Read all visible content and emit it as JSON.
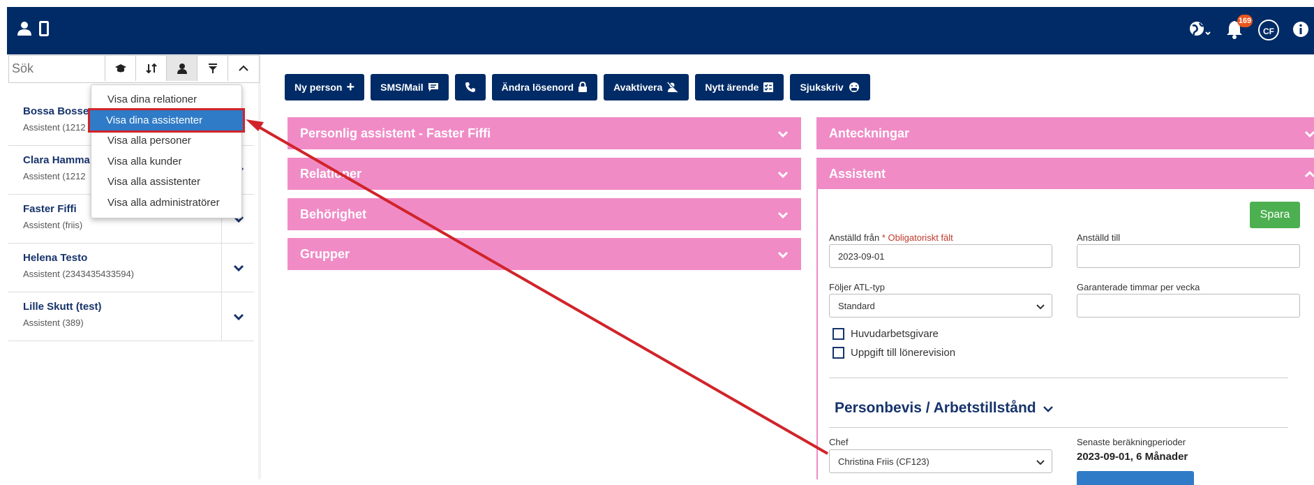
{
  "topbar": {
    "notification_count": "169",
    "user_initials": "CF"
  },
  "sidebar": {
    "search_placeholder": "Sök",
    "persons": [
      {
        "name": "Bossa Bosse",
        "sub": "Assistent (1212"
      },
      {
        "name": "Clara Hamma",
        "sub": "Assistent (1212"
      },
      {
        "name": "Faster Fiffi",
        "sub": "Assistent (friis)"
      },
      {
        "name": "Helena Testo",
        "sub": "Assistent (2343435433594)"
      },
      {
        "name": "Lille Skutt (test)",
        "sub": "Assistent (389)"
      }
    ]
  },
  "dropdown": {
    "items": [
      "Visa dina relationer",
      "Visa dina assistenter",
      "Visa alla personer",
      "Visa alla kunder",
      "Visa alla assistenter",
      "Visa alla administratörer"
    ],
    "selected_index": 1
  },
  "actions": {
    "new_person": "Ny person",
    "sms_mail": "SMS/Mail",
    "change_password": "Ändra lösenord",
    "deactivate": "Avaktivera",
    "new_case": "Nytt ärende",
    "sick_report": "Sjukskriv"
  },
  "panels_left": [
    "Personlig assistent - Faster Fiffi",
    "Relationer",
    "Behörighet",
    "Grupper"
  ],
  "panels_right": {
    "notes": "Anteckningar",
    "assistant": "Assistent"
  },
  "form": {
    "save": "Spara",
    "employed_from_label": "Anställd från",
    "required_note": "* Obligatoriskt fält",
    "employed_from_value": "2023-09-01",
    "employed_to_label": "Anställd till",
    "employed_to_value": "",
    "atl_label": "Följer ATL-typ",
    "atl_value": "Standard",
    "guaranteed_hours_label": "Garanterade timmar per vecka",
    "guaranteed_hours_value": "",
    "main_employer": "Huvudarbetsgivare",
    "salary_revision": "Uppgift till lönerevision",
    "section_title": "Personbevis / Arbetstillstånd",
    "manager_label": "Chef",
    "manager_value": "Christina Friis (CF123)",
    "latest_periods_label": "Senaste beräkningperioder",
    "latest_periods_value": "2023-09-01, 6 Månader"
  },
  "colors": {
    "navbar": "#002b66",
    "panel": "#f08bc6",
    "highlight": "#d0242a",
    "selected": "#2f7bc7",
    "save": "#4caf50"
  }
}
